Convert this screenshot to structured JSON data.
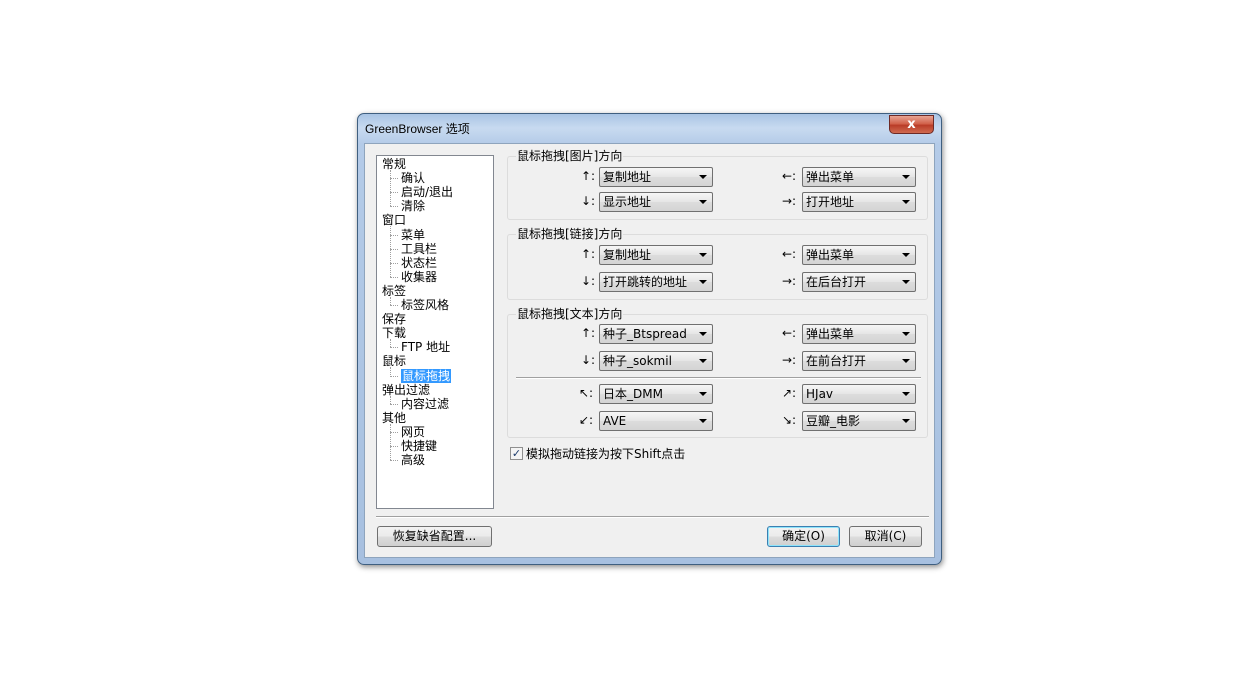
{
  "window": {
    "title": "GreenBrowser 选项",
    "close_icon": "x-icon"
  },
  "tree": [
    {
      "label": "常规",
      "level": 0
    },
    {
      "label": "确认",
      "level": 1
    },
    {
      "label": "启动/退出",
      "level": 1
    },
    {
      "label": "清除",
      "level": 1
    },
    {
      "label": "窗口",
      "level": 0
    },
    {
      "label": "菜单",
      "level": 1
    },
    {
      "label": "工具栏",
      "level": 1
    },
    {
      "label": "状态栏",
      "level": 1
    },
    {
      "label": "收集器",
      "level": 1
    },
    {
      "label": "标签",
      "level": 0
    },
    {
      "label": "标签风格",
      "level": 1
    },
    {
      "label": "保存",
      "level": 0
    },
    {
      "label": "下载",
      "level": 0
    },
    {
      "label": "FTP 地址",
      "level": 1
    },
    {
      "label": "鼠标",
      "level": 0
    },
    {
      "label": "鼠标拖拽",
      "level": 1,
      "selected": true
    },
    {
      "label": "弹出过滤",
      "level": 0
    },
    {
      "label": "内容过滤",
      "level": 1
    },
    {
      "label": "其他",
      "level": 0
    },
    {
      "label": "网页",
      "level": 1
    },
    {
      "label": "快捷键",
      "level": 1
    },
    {
      "label": "高级",
      "level": 1
    }
  ],
  "groups": {
    "image": {
      "title": "鼠标拖拽[图片]方向",
      "up_arrow": "↑:",
      "up_value": "复制地址",
      "left_arrow": "←:",
      "left_value": "弹出菜单",
      "down_arrow": "↓:",
      "down_value": "显示地址",
      "right_arrow": "→:",
      "right_value": "打开地址"
    },
    "link": {
      "title": "鼠标拖拽[链接]方向",
      "up_arrow": "↑:",
      "up_value": "复制地址",
      "left_arrow": "←:",
      "left_value": "弹出菜单",
      "down_arrow": "↓:",
      "down_value": "打开跳转的地址",
      "right_arrow": "→:",
      "right_value": "在后台打开"
    },
    "text": {
      "title": "鼠标拖拽[文本]方向",
      "up_arrow": "↑:",
      "up_value": "种子_Btspread",
      "left_arrow": "←:",
      "left_value": "弹出菜单",
      "down_arrow": "↓:",
      "down_value": "种子_sokmil",
      "right_arrow": "→:",
      "right_value": "在前台打开",
      "upleft_arrow": "↖:",
      "upleft_value": "日本_DMM",
      "upright_arrow": "↗:",
      "upright_value": "HJav",
      "downleft_arrow": "↙:",
      "downleft_value": "AVE",
      "downright_arrow": "↘:",
      "downright_value": "豆瓣_电影"
    }
  },
  "checkbox": {
    "label": "模拟拖动链接为按下Shift点击",
    "checked": true,
    "check_glyph": "✓"
  },
  "buttons": {
    "restore": "恢复缺省配置...",
    "ok": "确定(O)",
    "cancel": "取消(C)"
  }
}
